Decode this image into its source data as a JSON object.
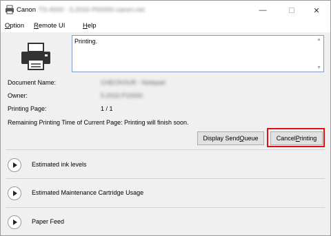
{
  "window": {
    "app_name": "Canon",
    "title_rest": "TS-4000 - 5.2016 P00000.canon.net",
    "controls": {
      "minimize": "—",
      "maximize": "☐",
      "close": "✕"
    }
  },
  "menu": {
    "option": {
      "accel": "O",
      "rest": "ption"
    },
    "remote": {
      "accel": "R",
      "rest": "emote UI"
    },
    "help": {
      "accel": "H",
      "rest": "elp"
    }
  },
  "status": {
    "message": "Printing."
  },
  "details": {
    "document_name": {
      "label": "Document Name:",
      "value": "CHECKOUR - Notepad"
    },
    "owner": {
      "label": "Owner:",
      "value": "5.2016 P10000"
    },
    "printing_page": {
      "label": "Printing Page:",
      "value": "1 / 1"
    },
    "remaining": {
      "label": "Remaining Printing Time of Current Page:",
      "value": "Printing will finish soon."
    }
  },
  "buttons": {
    "queue": {
      "pre": "Display Send ",
      "accel": "Q",
      "post": "ueue"
    },
    "cancel": {
      "pre": "Cancel ",
      "accel": "P",
      "post": "rinting"
    }
  },
  "sections": [
    {
      "label": "Estimated ink levels"
    },
    {
      "label": "Estimated Maintenance Cartridge Usage"
    },
    {
      "label": "Paper Feed"
    }
  ],
  "colors": {
    "highlight": "#e01010",
    "message_border": "#7a9cc6"
  }
}
